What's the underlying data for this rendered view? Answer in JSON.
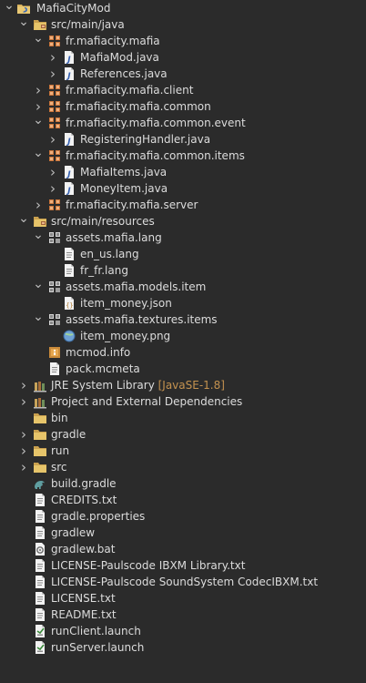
{
  "project_explorer": {
    "items": [
      {
        "label": "MafiaCityMod",
        "depth": 0,
        "toggle": "open",
        "icon": "project-icon",
        "name": "project-mafiacitymod"
      },
      {
        "label": "src/main/java",
        "depth": 1,
        "toggle": "open",
        "icon": "source-folder-icon",
        "name": "source-folder-java"
      },
      {
        "label": "fr.mafiacity.mafia",
        "depth": 2,
        "toggle": "open",
        "icon": "package-icon",
        "name": "package-mafia"
      },
      {
        "label": "MafiaMod.java",
        "depth": 3,
        "toggle": "closed",
        "icon": "java-file-icon",
        "name": "file-mafiamod-java"
      },
      {
        "label": "References.java",
        "depth": 3,
        "toggle": "closed",
        "icon": "java-file-icon",
        "name": "file-references-java"
      },
      {
        "label": "fr.mafiacity.mafia.client",
        "depth": 2,
        "toggle": "closed",
        "icon": "package-icon",
        "name": "package-client"
      },
      {
        "label": "fr.mafiacity.mafia.common",
        "depth": 2,
        "toggle": "closed",
        "icon": "package-icon",
        "name": "package-common"
      },
      {
        "label": "fr.mafiacity.mafia.common.event",
        "depth": 2,
        "toggle": "open",
        "icon": "package-icon",
        "name": "package-common-event"
      },
      {
        "label": "RegisteringHandler.java",
        "depth": 3,
        "toggle": "closed",
        "icon": "java-file-icon",
        "name": "file-registeringhandler-java"
      },
      {
        "label": "fr.mafiacity.mafia.common.items",
        "depth": 2,
        "toggle": "open",
        "icon": "package-icon",
        "name": "package-common-items"
      },
      {
        "label": "MafiaItems.java",
        "depth": 3,
        "toggle": "closed",
        "icon": "java-file-icon",
        "name": "file-mafiaitems-java"
      },
      {
        "label": "MoneyItem.java",
        "depth": 3,
        "toggle": "closed",
        "icon": "java-file-icon",
        "name": "file-moneyitem-java"
      },
      {
        "label": "fr.mafiacity.mafia.server",
        "depth": 2,
        "toggle": "closed",
        "icon": "package-icon",
        "name": "package-server"
      },
      {
        "label": "src/main/resources",
        "depth": 1,
        "toggle": "open",
        "icon": "source-folder-icon",
        "name": "source-folder-resources"
      },
      {
        "label": "assets.mafia.lang",
        "depth": 2,
        "toggle": "open",
        "icon": "resource-package-icon",
        "name": "package-assets-lang"
      },
      {
        "label": "en_us.lang",
        "depth": 3,
        "toggle": "none",
        "icon": "text-file-icon",
        "name": "file-en-us-lang"
      },
      {
        "label": "fr_fr.lang",
        "depth": 3,
        "toggle": "none",
        "icon": "text-file-icon",
        "name": "file-fr-fr-lang"
      },
      {
        "label": "assets.mafia.models.item",
        "depth": 2,
        "toggle": "open",
        "icon": "resource-package-icon",
        "name": "package-assets-models-item"
      },
      {
        "label": "item_money.json",
        "depth": 3,
        "toggle": "none",
        "icon": "json-file-icon",
        "name": "file-item-money-json"
      },
      {
        "label": "assets.mafia.textures.items",
        "depth": 2,
        "toggle": "open",
        "icon": "resource-package-icon",
        "name": "package-assets-textures-items"
      },
      {
        "label": "item_money.png",
        "depth": 3,
        "toggle": "none",
        "icon": "image-file-icon",
        "name": "file-item-money-png"
      },
      {
        "label": "mcmod.info",
        "depth": 2,
        "toggle": "none",
        "icon": "info-file-icon",
        "name": "file-mcmod-info"
      },
      {
        "label": "pack.mcmeta",
        "depth": 2,
        "toggle": "none",
        "icon": "text-file-icon",
        "name": "file-pack-mcmeta"
      },
      {
        "label": "JRE System Library",
        "decoration": "[JavaSE-1.8]",
        "depth": 1,
        "toggle": "closed",
        "icon": "library-icon",
        "name": "jre-system-library"
      },
      {
        "label": "Project and External Dependencies",
        "depth": 1,
        "toggle": "closed",
        "icon": "library-icon",
        "name": "project-external-dependencies"
      },
      {
        "label": "bin",
        "depth": 1,
        "toggle": "none",
        "icon": "folder-icon",
        "name": "folder-bin"
      },
      {
        "label": "gradle",
        "depth": 1,
        "toggle": "closed",
        "icon": "folder-icon",
        "name": "folder-gradle"
      },
      {
        "label": "run",
        "depth": 1,
        "toggle": "closed",
        "icon": "folder-icon",
        "name": "folder-run"
      },
      {
        "label": "src",
        "depth": 1,
        "toggle": "closed",
        "icon": "folder-icon",
        "name": "folder-src"
      },
      {
        "label": "build.gradle",
        "depth": 1,
        "toggle": "none",
        "icon": "gradle-file-icon",
        "name": "file-build-gradle"
      },
      {
        "label": "CREDITS.txt",
        "depth": 1,
        "toggle": "none",
        "icon": "text-file-icon",
        "name": "file-credits-txt"
      },
      {
        "label": "gradle.properties",
        "depth": 1,
        "toggle": "none",
        "icon": "text-file-icon",
        "name": "file-gradle-properties"
      },
      {
        "label": "gradlew",
        "depth": 1,
        "toggle": "none",
        "icon": "text-file-icon",
        "name": "file-gradlew"
      },
      {
        "label": "gradlew.bat",
        "depth": 1,
        "toggle": "none",
        "icon": "batch-file-icon",
        "name": "file-gradlew-bat"
      },
      {
        "label": "LICENSE-Paulscode IBXM Library.txt",
        "depth": 1,
        "toggle": "none",
        "icon": "text-file-icon",
        "name": "file-license-ibxm"
      },
      {
        "label": "LICENSE-Paulscode SoundSystem CodecIBXM.txt",
        "depth": 1,
        "toggle": "none",
        "icon": "text-file-icon",
        "name": "file-license-soundsystem"
      },
      {
        "label": "LICENSE.txt",
        "depth": 1,
        "toggle": "none",
        "icon": "text-file-icon",
        "name": "file-license-txt"
      },
      {
        "label": "README.txt",
        "depth": 1,
        "toggle": "none",
        "icon": "text-file-icon",
        "name": "file-readme-txt"
      },
      {
        "label": "runClient.launch",
        "depth": 1,
        "toggle": "none",
        "icon": "launch-file-icon",
        "name": "file-runclient-launch"
      },
      {
        "label": "runServer.launch",
        "depth": 1,
        "toggle": "none",
        "icon": "launch-file-icon",
        "name": "file-runserver-launch"
      }
    ]
  },
  "colors": {
    "background": "#2b2b2b",
    "text": "#dcdcdc",
    "decoration": "#c4924f",
    "folder": "#d8b25c",
    "package": "#c8743a",
    "java_file": "#6a8fc8"
  }
}
